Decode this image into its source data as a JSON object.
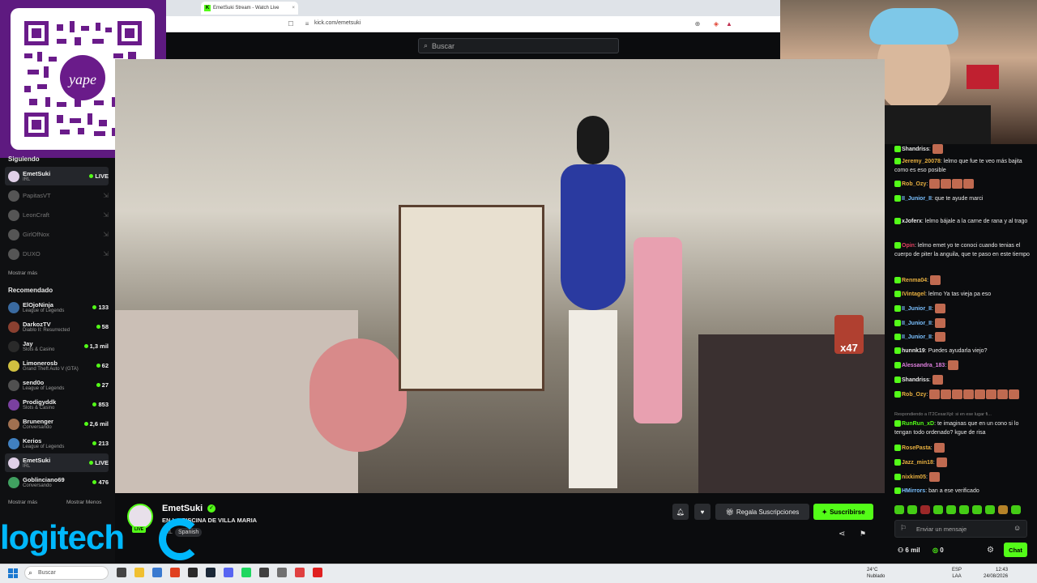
{
  "browser": {
    "tab_title": "EmetSuki Stream - Watch Live",
    "url": "kick.com/emetsuki"
  },
  "kick": {
    "search_placeholder": "Buscar"
  },
  "sidebar": {
    "following_heading": "Siguiendo",
    "following": [
      {
        "name": "EmetSuki",
        "category": "IRL",
        "status": "LIVE",
        "live": true
      },
      {
        "name": "PapitasVT",
        "live": false
      },
      {
        "name": "LeonCraft",
        "live": false
      },
      {
        "name": "GirlOfNox",
        "live": false
      },
      {
        "name": "DUXO",
        "live": false
      }
    ],
    "show_more": "Mostrar más",
    "recommended_heading": "Recomendado",
    "recommended": [
      {
        "name": "ElOjoNinja",
        "category": "League of Legends",
        "viewers": "133"
      },
      {
        "name": "DarkozTV",
        "category": "Diablo II: Resurrected",
        "viewers": "58"
      },
      {
        "name": "Jay",
        "category": "Slots & Casino",
        "viewers": "1,3 mil"
      },
      {
        "name": "Limonerosb",
        "category": "Grand Theft Auto V (GTA)",
        "viewers": "62"
      },
      {
        "name": "send0o",
        "category": "League of Legends",
        "viewers": "27"
      },
      {
        "name": "Prodigyddk",
        "category": "Slots & Casino",
        "viewers": "853"
      },
      {
        "name": "Brunenger",
        "category": "Conversando",
        "viewers": "2,6 mil"
      },
      {
        "name": "Kerios",
        "category": "League of Legends",
        "viewers": "213"
      },
      {
        "name": "EmetSuki",
        "category": "IRL",
        "viewers": "LIVE"
      },
      {
        "name": "Goblinciano69",
        "category": "Conversando",
        "viewers": "476"
      }
    ],
    "show_more_2": "Mostrar más",
    "show_less": "Mostrar Menos"
  },
  "video": {
    "overlay_count": "x47"
  },
  "stream": {
    "streamer": "EmetSuki",
    "live_label": "LIVE",
    "title": "EN LA PISCINA DE VILLA MARIA",
    "category": "IRL",
    "language": "Spanish",
    "gift_label": "Regala Suscripciones",
    "subscribe_label": "Suscribirse"
  },
  "brand_overlay": "logitech",
  "chat": {
    "messages": [
      {
        "user": "Shandriss",
        "text": "",
        "color": "#e8e8e8",
        "emotes": 1
      },
      {
        "user": "Jeremy_20078",
        "text": "lelmo que fue te veo más bajita como es eso posible",
        "color": "#e8b040",
        "emotes": 0
      },
      {
        "user": "Rob_Ozy",
        "text": "",
        "color": "#e8b040",
        "emotes": 4
      },
      {
        "user": "II_Junior_II",
        "text": "que te ayude marci",
        "color": "#7ac0ff",
        "emotes": 0
      },
      {
        "user": "xJoferx",
        "text": "lelmo bájale a la carne de rana y al trago",
        "color": "#e8e8e8",
        "emotes": 0
      },
      {
        "user": "Opin",
        "text": "lelmo emet yo te conoci cuando tenias el cuerpo de piter la anguila, que te paso en este tiempo",
        "color": "#e04060",
        "emotes": 0
      },
      {
        "user": "Renma04",
        "text": "",
        "color": "#e8b040",
        "emotes": 1
      },
      {
        "user": "IVintagel",
        "text": "lelmo Ya tas vieja pa eso",
        "color": "#e8b040",
        "emotes": 0
      },
      {
        "user": "II_Junior_II",
        "text": "",
        "color": "#7ac0ff",
        "emotes": 1
      },
      {
        "user": "II_Junior_II",
        "text": "",
        "color": "#7ac0ff",
        "emotes": 1
      },
      {
        "user": "II_Junior_II",
        "text": "",
        "color": "#7ac0ff",
        "emotes": 1
      },
      {
        "user": "hunnk19",
        "text": "Puedes ayudarla viejo?",
        "color": "#e8e8e8",
        "emotes": 0
      },
      {
        "user": "Alessandra_183",
        "text": "",
        "color": "#e080e0",
        "emotes": 1
      },
      {
        "user": "Shandriss",
        "text": "",
        "color": "#e8e8e8",
        "emotes": 1
      },
      {
        "user": "Rob_Ozy",
        "text": "",
        "color": "#e8b040",
        "emotes": 8
      },
      {
        "user": "RunRun_xD",
        "text": "te imaginas que en un cono si lo tengan todo ordenado? kgue de risa",
        "color": "#53fc18",
        "emotes": 0
      },
      {
        "user": "RosePasta",
        "text": "",
        "color": "#e8b040",
        "emotes": 1
      },
      {
        "user": "Jazz_min18",
        "text": "",
        "color": "#e8b040",
        "emotes": 1
      },
      {
        "user": "nixkim05",
        "text": "",
        "color": "#e8b040",
        "emotes": 1
      },
      {
        "user": "HMirrors",
        "text": "ban a ese verificado",
        "color": "#7ac0ff",
        "emotes": 0
      }
    ],
    "reply_note": "Respondiendo a IT2CesarXpl: si en ese lugar fi...",
    "input_placeholder": "Enviar un mensaje",
    "viewers": "6 mil",
    "points": "0",
    "chat_button": "Chat"
  },
  "taskbar": {
    "search_placeholder": "Buscar",
    "weather_temp": "24°C",
    "weather_text": "Nublado",
    "lang": "ESP",
    "lang_sub": "LAA",
    "time": "12:43",
    "date": "24/08/2026"
  },
  "colors": {
    "kick_green": "#53fc18",
    "qr_purple": "#5e1a80",
    "logitech_blue": "#00b8fc"
  }
}
